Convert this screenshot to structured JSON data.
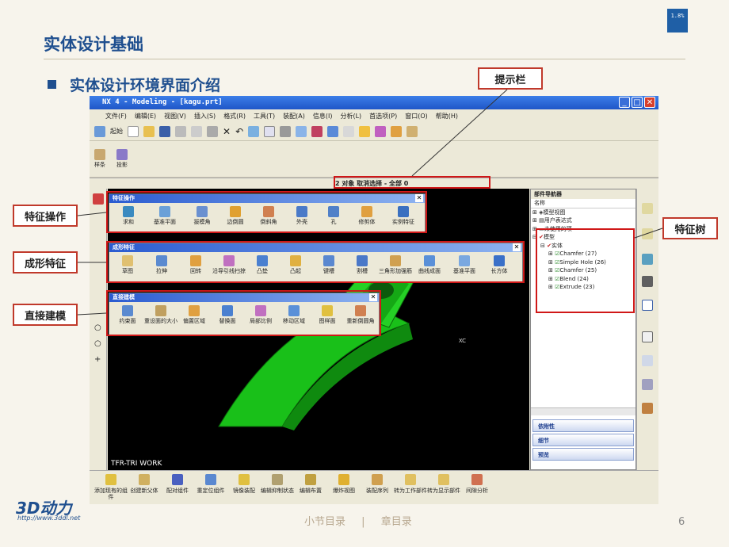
{
  "progress_badge": "1.8%",
  "slide": {
    "title": "实体设计基础",
    "bullet": "实体设计环境界面介绍"
  },
  "callouts": {
    "prompt_bar": "提示栏",
    "feature_ops": "特征操作",
    "form_features": "成形特征",
    "direct_modeling": "直接建模",
    "feature_tree": "特征树"
  },
  "app": {
    "title": "NX 4 - Modeling - [kagu.prt]",
    "menus": [
      "文件(F)",
      "编辑(E)",
      "视图(V)",
      "插入(S)",
      "格式(R)",
      "工具(T)",
      "装配(A)",
      "信息(I)",
      "分析(L)",
      "首选项(P)",
      "窗口(O)",
      "帮助(H)"
    ],
    "start_label": "起始",
    "sketch_toolbar": [
      "样条",
      "投影"
    ],
    "status": "2 对象 取消选择 - 全部 0",
    "canvas_label": "TFR-TRI WORK",
    "axis_label": "XC"
  },
  "palettes": {
    "feature_ops": {
      "title": "特征操作",
      "items": [
        "求和",
        "基准平面",
        "拔模角",
        "边倒圆",
        "倒斜角",
        "外壳",
        "孔",
        "修剪体",
        "实例特征"
      ]
    },
    "form_features": {
      "title": "成形特征",
      "items": [
        "草图",
        "拉伸",
        "回转",
        "沿导引线扫掠",
        "凸垫",
        "凸起",
        "键槽",
        "割槽",
        "三角形加强筋",
        "曲线成面",
        "基准平面",
        "长方体"
      ]
    },
    "direct_modeling": {
      "title": "直接建模",
      "items": [
        "约束面",
        "重设面的大小",
        "偏置区域",
        "替换面",
        "局部比例",
        "移动区域",
        "图样面",
        "重新倒圆角"
      ]
    }
  },
  "navigator": {
    "title": "部件导航器",
    "column": "名称",
    "items": [
      "模型视图",
      "用户表达式",
      "未使用的项",
      "模型",
      "实体",
      "Chamfer (27)",
      "Simple Hole (26)",
      "Chamfer (25)",
      "Blend (24)",
      "Extrude (23)"
    ],
    "sections": [
      "依附性",
      "细节",
      "预览"
    ]
  },
  "bottom_toolbar": [
    "添加现有的组件",
    "创建新父体",
    "配对组件",
    "重定位组件",
    "镜像装配",
    "编辑抑制状态",
    "编辑布置",
    "爆炸视图",
    "装配序列",
    "转为工作部件",
    "转为显示部件",
    "间隙分析"
  ],
  "logo": {
    "text": "3D动力",
    "url": "http://www.3ddl.net"
  },
  "footer": {
    "section_toc": "小节目录",
    "separator": "|",
    "chapter_toc": "章目录"
  },
  "page_number": "6",
  "colors": {
    "accent": "#1f4f8f",
    "callout_border": "#c0392b",
    "part": "#19c019",
    "canvas": "#000000"
  }
}
